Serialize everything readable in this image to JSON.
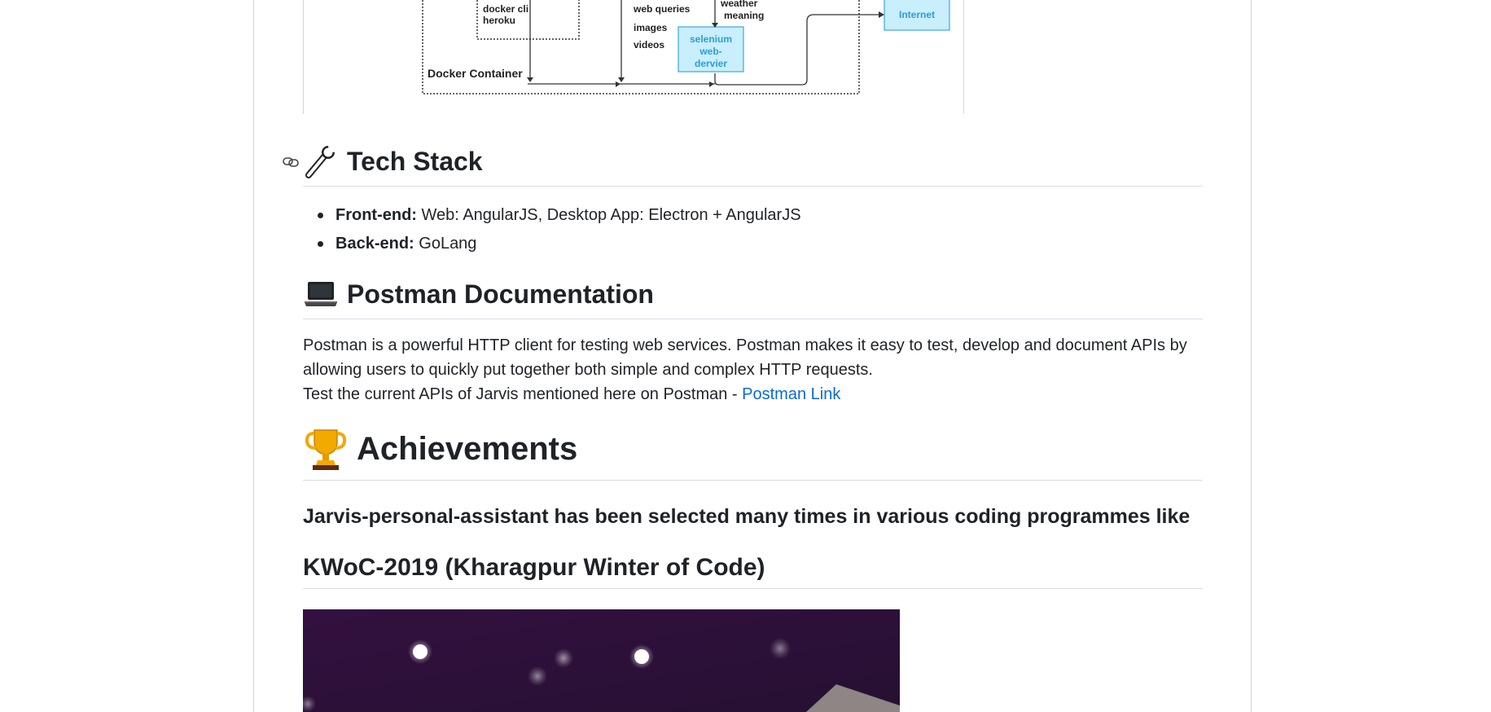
{
  "diagram": {
    "labels": {
      "docker_cli": "docker cli",
      "heroku": "heroku",
      "docker_container": "Docker Container",
      "web_queries": "web queries",
      "images": "images",
      "videos": "videos",
      "weather": "weather",
      "meaning": "meaning",
      "selenium_1": "selenium",
      "selenium_2": "web-",
      "selenium_3": "dervier",
      "internet": "Internet"
    },
    "colors": {
      "box_fill": "#c9eefc",
      "box_stroke": "#39a9e0",
      "box_text": "#2a9fd8"
    }
  },
  "tech_stack": {
    "heading": "Tech Stack",
    "icon": "wrench-icon",
    "items": [
      {
        "label": "Front-end:",
        "value": " Web: AngularJS, Desktop App: Electron + AngularJS"
      },
      {
        "label": "Back-end:",
        "value": " GoLang"
      }
    ]
  },
  "postman": {
    "heading": "Postman Documentation",
    "icon": "laptop-icon",
    "line1": "Postman is a powerful HTTP client for testing web services. Postman makes it easy to test, develop and document APIs by",
    "line2": "allowing users to quickly put together both simple and complex HTTP requests.",
    "line3_prefix": "Test the current APIs of Jarvis mentioned here on Postman - ",
    "link_text": "Postman Link"
  },
  "achievements": {
    "heading": "Achievements",
    "icon": "trophy-icon",
    "subheading": "Jarvis-personal-assistant has been selected many times in various coding programmes like",
    "kwoc_heading": "KWoC-2019 (Kharagpur Winter of Code)"
  },
  "colors": {
    "link": "#0969da",
    "banner_bg": "#2b0f35",
    "border": "#d8dee4"
  }
}
